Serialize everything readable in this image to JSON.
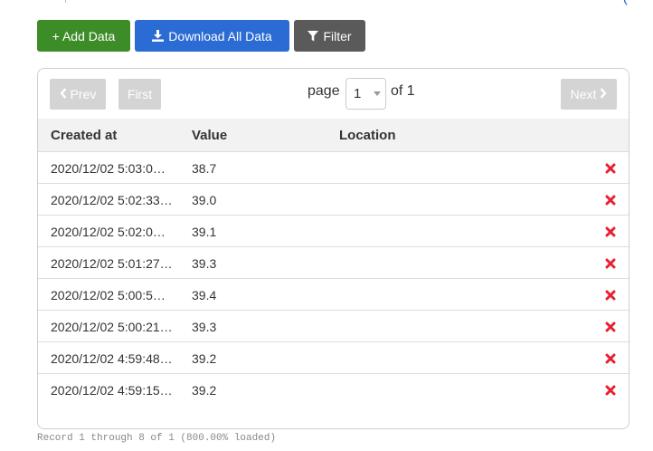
{
  "toolbar": {
    "add_label": "+ Add Data",
    "download_label": "Download All Data",
    "filter_label": "Filter",
    "colors": {
      "add": "#3c8d28",
      "download": "#2a6bd4",
      "filter": "#5a5a5a"
    }
  },
  "pager": {
    "prev_label": "Prev",
    "first_label": "First",
    "next_label": "Next",
    "page_label": "page",
    "page_value": "1",
    "of_label": "of 1"
  },
  "table": {
    "headers": {
      "created": "Created at",
      "value": "Value",
      "location": "Location"
    },
    "rows": [
      {
        "created": "2020/12/02 5:03:0…",
        "value": "38.7",
        "location": ""
      },
      {
        "created": "2020/12/02 5:02:33…",
        "value": "39.0",
        "location": ""
      },
      {
        "created": "2020/12/02 5:02:0…",
        "value": "39.1",
        "location": ""
      },
      {
        "created": "2020/12/02 5:01:27…",
        "value": "39.3",
        "location": ""
      },
      {
        "created": "2020/12/02 5:00:5…",
        "value": "39.4",
        "location": ""
      },
      {
        "created": "2020/12/02 5:00:21…",
        "value": "39.3",
        "location": ""
      },
      {
        "created": "2020/12/02 4:59:48…",
        "value": "39.2",
        "location": ""
      },
      {
        "created": "2020/12/02 4:59:15…",
        "value": "39.2",
        "location": ""
      }
    ],
    "delete_icon": "close-icon",
    "delete_color": "#e8202f"
  },
  "footer": {
    "text": "Record 1 through 8 of 1 (800.00% loaded)"
  },
  "top_partial": {
    "paren": "("
  }
}
